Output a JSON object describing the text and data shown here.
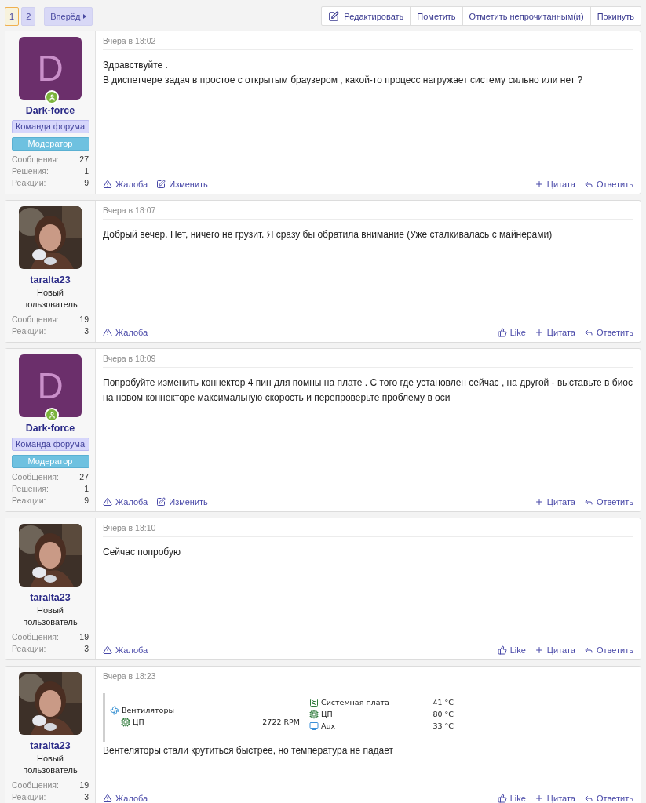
{
  "pagination": {
    "pages": [
      {
        "label": "1",
        "selected": true
      },
      {
        "label": "2",
        "selected": false
      }
    ],
    "next": "Вперёд"
  },
  "toolbar": [
    {
      "label": "Редактировать",
      "kind": "edit"
    },
    {
      "label": "Пометить",
      "kind": "plain"
    },
    {
      "label": "Отметить непрочитанным(и)",
      "kind": "plain"
    },
    {
      "label": "Покинуть",
      "kind": "plain"
    }
  ],
  "posts": [
    {
      "user": {
        "name": "Dark-force",
        "avatar": {
          "kind": "letter",
          "letter": "D"
        },
        "online": true,
        "banners": [
          {
            "label": "Команда форума",
            "kind": "team"
          },
          {
            "label": "Модератор",
            "kind": "moderator"
          }
        ],
        "stats": [
          {
            "label": "Сообщения:",
            "value": "27"
          },
          {
            "label": "Решения:",
            "value": "1"
          },
          {
            "label": "Реакции:",
            "value": "9"
          }
        ]
      },
      "time": "Вчера в 18:02",
      "body": [
        "Здравствуйте .",
        "В диспетчере задач в простое с открытым браузером , какой-то процесс нагружает систему сильно или нет ?"
      ],
      "actions_left": [
        {
          "label": "Жалоба",
          "kind": "report"
        },
        {
          "label": "Изменить",
          "kind": "edit"
        }
      ],
      "actions_right": [
        {
          "label": "Цитата",
          "kind": "quote"
        },
        {
          "label": "Ответить",
          "kind": "reply"
        }
      ]
    },
    {
      "user": {
        "name": "taralta23",
        "online": false,
        "title": "Новый пользователь",
        "stats": [
          {
            "label": "Сообщения:",
            "value": "19"
          },
          {
            "label": "Реакции:",
            "value": "3"
          }
        ]
      },
      "time": "Вчера в 18:07",
      "body": [
        "Добрый вечер. Нет, ничего не грузит. Я сразу бы обратила внимание (Уже сталкивалась с майнерами)"
      ],
      "actions_left": [
        {
          "label": "Жалоба",
          "kind": "report"
        }
      ],
      "actions_right": [
        {
          "label": "Like",
          "kind": "like"
        },
        {
          "label": "Цитата",
          "kind": "quote"
        },
        {
          "label": "Ответить",
          "kind": "reply"
        }
      ]
    },
    {
      "user": {
        "name": "Dark-force",
        "avatar": {
          "kind": "letter",
          "letter": "D"
        },
        "online": true,
        "banners": [
          {
            "label": "Команда форума",
            "kind": "team"
          },
          {
            "label": "Модератор",
            "kind": "moderator"
          }
        ],
        "stats": [
          {
            "label": "Сообщения:",
            "value": "27"
          },
          {
            "label": "Решения:",
            "value": "1"
          },
          {
            "label": "Реакции:",
            "value": "9"
          }
        ]
      },
      "time": "Вчера в 18:09",
      "body": [
        "Попробуйте изменить коннектор 4 пин для помны на плате . С того где установлен сейчас , на другой - выставьте в биос на новом коннекторе максимальную скорость и перепроверьте проблему в оси"
      ],
      "actions_left": [
        {
          "label": "Жалоба",
          "kind": "report"
        },
        {
          "label": "Изменить",
          "kind": "edit"
        }
      ],
      "actions_right": [
        {
          "label": "Цитата",
          "kind": "quote"
        },
        {
          "label": "Ответить",
          "kind": "reply"
        }
      ]
    },
    {
      "user": {
        "name": "taralta23",
        "online": false,
        "title": "Новый пользователь",
        "stats": [
          {
            "label": "Сообщения:",
            "value": "19"
          },
          {
            "label": "Реакции:",
            "value": "3"
          }
        ]
      },
      "time": "Вчера в 18:10",
      "body": [
        "Сейчас попробую"
      ],
      "actions_left": [
        {
          "label": "Жалоба",
          "kind": "report"
        }
      ],
      "actions_right": [
        {
          "label": "Like",
          "kind": "like"
        },
        {
          "label": "Цитата",
          "kind": "quote"
        },
        {
          "label": "Ответить",
          "kind": "reply"
        }
      ]
    },
    {
      "user": {
        "name": "taralta23",
        "online": false,
        "title": "Новый пользователь",
        "stats": [
          {
            "label": "Сообщения:",
            "value": "19"
          },
          {
            "label": "Реакции:",
            "value": "3"
          }
        ]
      },
      "time": "Вчера в 18:23",
      "screenshot": {
        "fans": {
          "heading": "Вентиляторы",
          "rows": [
            {
              "label": "ЦП",
              "value": "2722 RPM"
            }
          ]
        },
        "temps": [
          {
            "label": "Системная плата",
            "value": "41 °C",
            "kind": "board"
          },
          {
            "label": "ЦП",
            "value": "80 °C",
            "kind": "cpu"
          },
          {
            "label": "Aux",
            "value": "33 °C",
            "kind": "aux"
          }
        ]
      },
      "body": [
        "Вентеляторы стали крутиться быстрее, но температура не падает"
      ],
      "actions_left": [
        {
          "label": "Жалоба",
          "kind": "report"
        }
      ],
      "actions_right": [
        {
          "label": "Like",
          "kind": "like"
        },
        {
          "label": "Цитата",
          "kind": "quote"
        },
        {
          "label": "Ответить",
          "kind": "reply"
        }
      ]
    }
  ]
}
